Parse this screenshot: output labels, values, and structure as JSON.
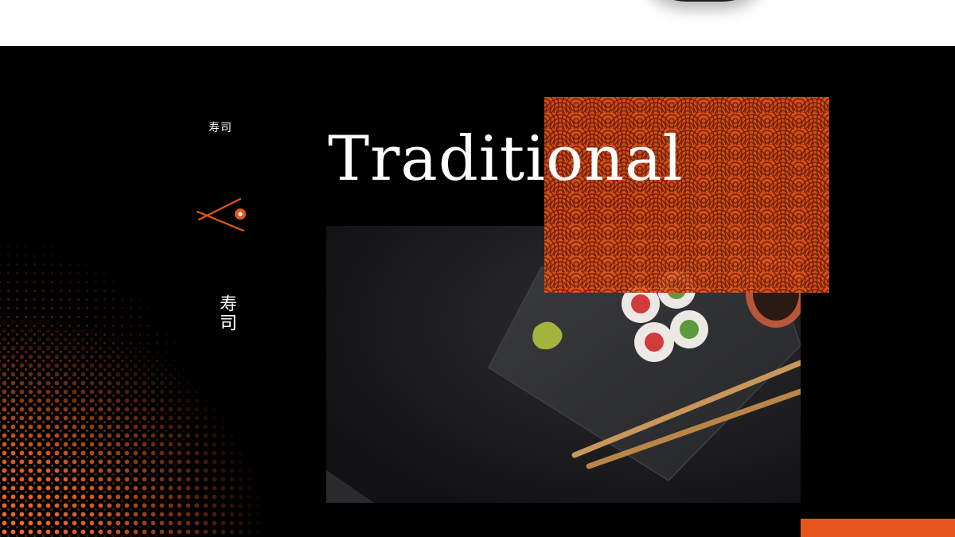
{
  "brand": {
    "kanji_small": "寿司",
    "kanji_vertical": "寿司"
  },
  "slide": {
    "title": "Traditional"
  },
  "colors": {
    "background": "#000000",
    "accent": "#e4561c",
    "text": "#ffffff"
  },
  "icons": {
    "logo": "chopsticks-logo-icon"
  }
}
